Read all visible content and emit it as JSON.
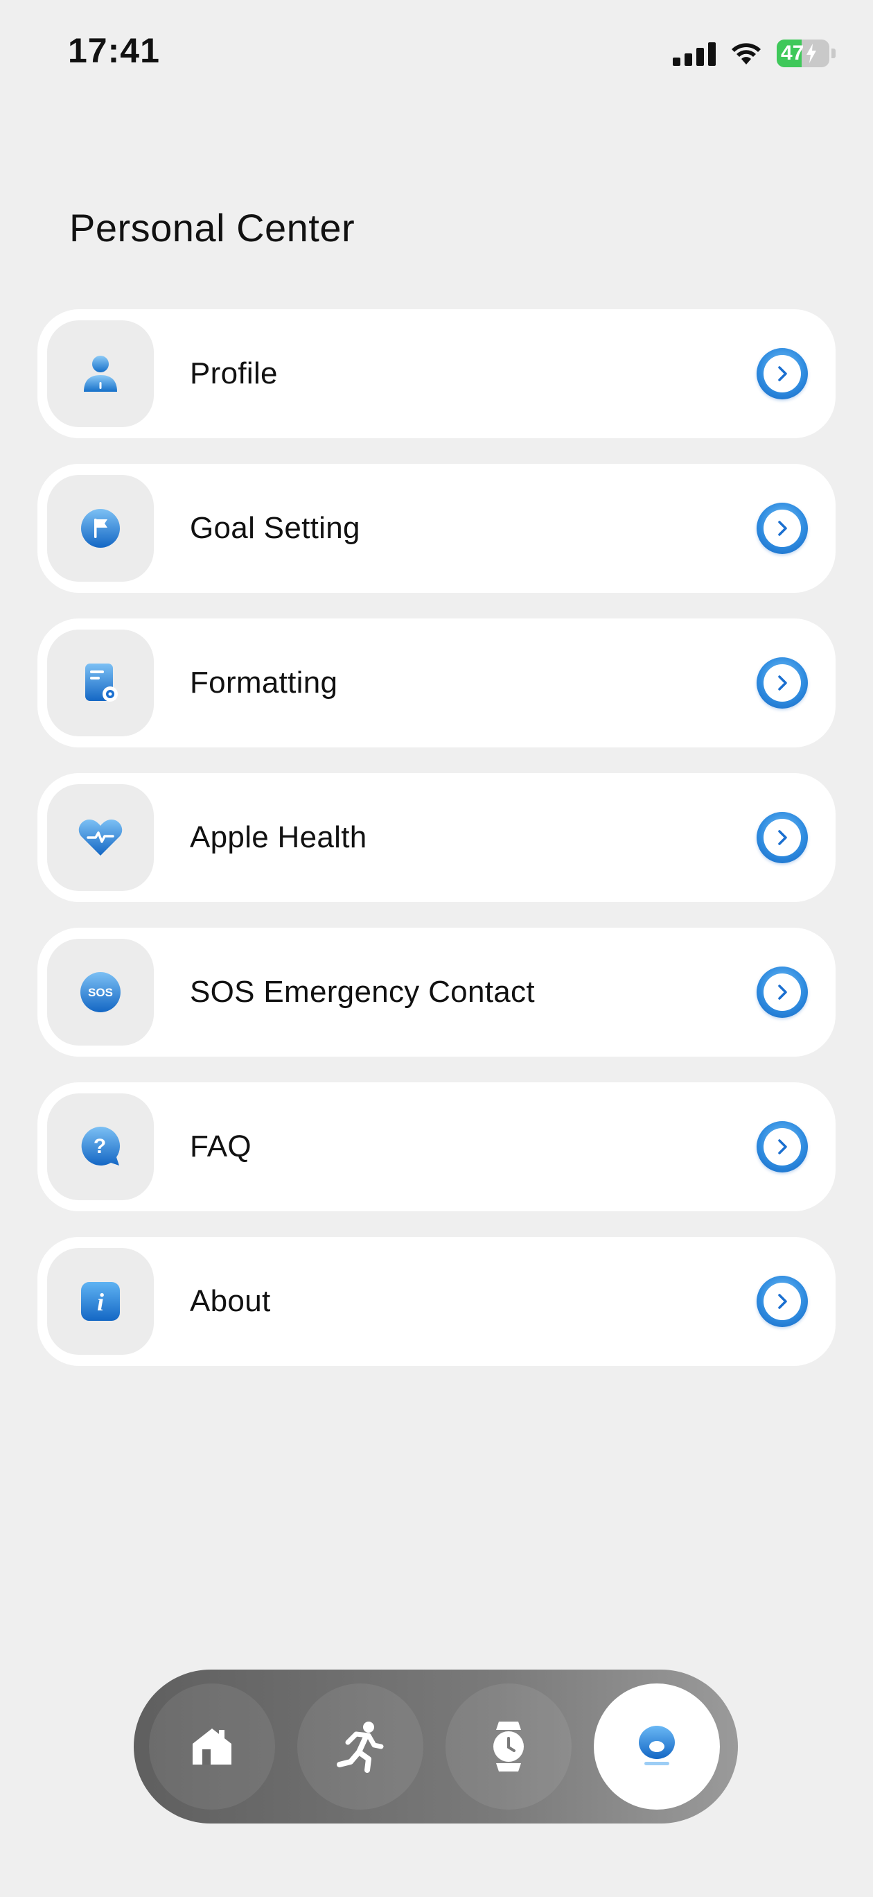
{
  "status": {
    "time": "17:41",
    "battery": "47",
    "battery_level": 0.47
  },
  "page": {
    "title": "Personal Center"
  },
  "menu": [
    {
      "label": "Profile",
      "icon": "user-icon"
    },
    {
      "label": "Goal Setting",
      "icon": "flag-icon"
    },
    {
      "label": "Formatting",
      "icon": "document-settings-icon"
    },
    {
      "label": "Apple Health",
      "icon": "heart-pulse-icon"
    },
    {
      "label": "SOS Emergency Contact",
      "icon": "sos-icon",
      "icon_text": "SOS"
    },
    {
      "label": "FAQ",
      "icon": "question-bubble-icon",
      "icon_text": "?"
    },
    {
      "label": "About",
      "icon": "info-icon",
      "icon_text": "i"
    }
  ],
  "tabbar": {
    "tabs": [
      {
        "name": "home",
        "icon": "home-icon",
        "active": false
      },
      {
        "name": "workout",
        "icon": "running-icon",
        "active": false
      },
      {
        "name": "device",
        "icon": "watch-icon",
        "active": false
      },
      {
        "name": "personal",
        "icon": "person-icon",
        "active": true
      }
    ]
  },
  "colors": {
    "accent": "#2f8ce0",
    "background": "#efefef",
    "battery": "#3fc85a"
  }
}
